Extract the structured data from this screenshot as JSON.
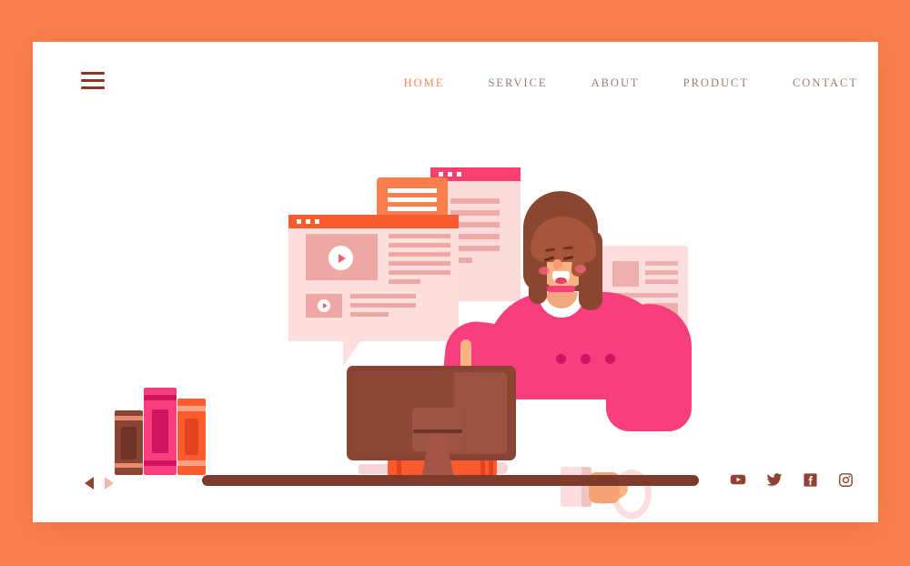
{
  "theme": {
    "page_background": "#fb7f4c",
    "card_background": "#ffffff",
    "accent_orange": "#f5855c",
    "nav_text": "#9d7a70",
    "brand_brown": "#8e3722",
    "hot_pink": "#f93e7f",
    "bright_orange": "#fb5c2d",
    "title_pink": "#fb3f6f",
    "desk_brown": "#7c3b2b"
  },
  "header": {
    "menu_icon": "hamburger-menu-icon",
    "nav": [
      {
        "label": "HOME",
        "active": true
      },
      {
        "label": "SERVICE",
        "active": false
      },
      {
        "label": "ABOUT",
        "active": false
      },
      {
        "label": "PRODUCT",
        "active": false
      },
      {
        "label": "CONTACT",
        "active": false
      }
    ]
  },
  "illustration": {
    "alt": "woman at desk with computer, browser windows, chat bubble and books",
    "browser_window_front": {
      "titlebar_color": "#fb5c2d",
      "dots": 3,
      "video_thumbnail_play": "play-icon",
      "small_thumbnail_play": "play-icon",
      "text_line_count": 9
    },
    "browser_window_back": {
      "titlebar_color": "#fb3f6f",
      "dots": 3,
      "text_line_count": 6
    },
    "speech_bubble": {
      "color": "#fb7f4c",
      "line_count": 3
    },
    "article_card": {
      "background": "#fbdedd",
      "image_blocks": 2,
      "text_line_count": 9
    },
    "character": {
      "sweater_color": "#f93e7f",
      "hair_color": "#8b4630",
      "button_count": 3,
      "holding": "coffee-mug",
      "gesture": "pointing-finger"
    },
    "desk_items": [
      "monitor",
      "keyboard",
      "mouse",
      "books",
      "horizontal-book"
    ],
    "books_vertical": [
      {
        "color": "#8a4434",
        "accent": "#e98a72"
      },
      {
        "color": "#f93e7f",
        "accent": "#cf1462"
      },
      {
        "color": "#fb5c2d",
        "accent": "#f9a285"
      }
    ]
  },
  "footer": {
    "prev_label": "prev-slide",
    "next_label": "next-slide",
    "socials": [
      {
        "name": "youtube",
        "label": "YouTube"
      },
      {
        "name": "twitter",
        "label": "Twitter"
      },
      {
        "name": "facebook",
        "label": "Facebook"
      },
      {
        "name": "instagram",
        "label": "Instagram"
      }
    ]
  }
}
